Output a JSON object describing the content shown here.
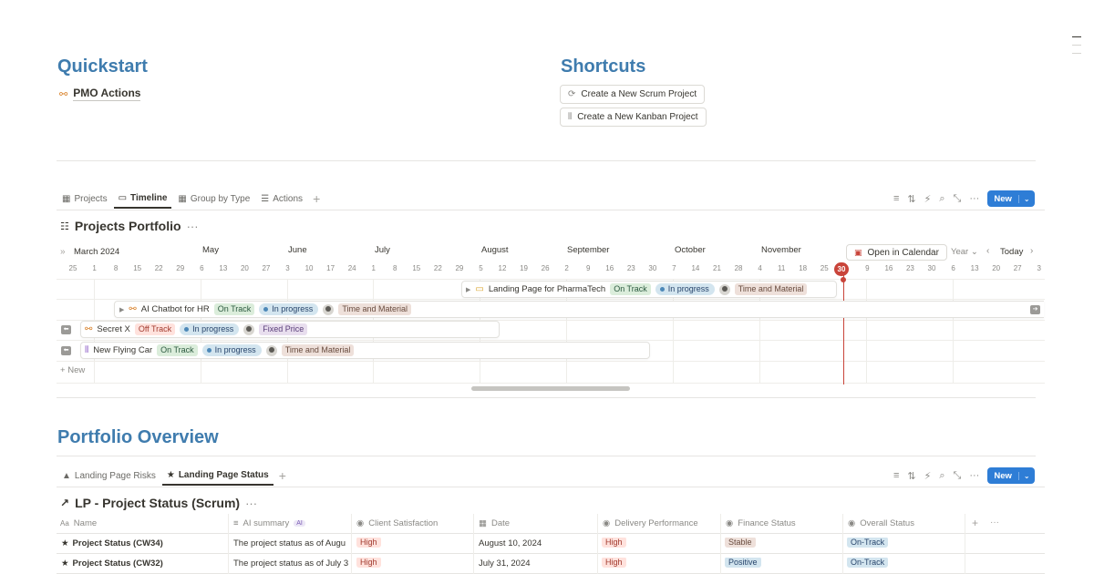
{
  "quickstart": {
    "title": "Quickstart",
    "items": [
      {
        "label": "PMO Actions"
      }
    ]
  },
  "shortcuts": {
    "title": "Shortcuts",
    "buttons": [
      {
        "label": "Create a New Scrum Project"
      },
      {
        "label": "Create a New Kanban Project"
      }
    ]
  },
  "projects_view": {
    "tabs": [
      {
        "label": "Projects"
      },
      {
        "label": "Timeline"
      },
      {
        "label": "Group by Type"
      },
      {
        "label": "Actions"
      }
    ],
    "active_tab": "Timeline",
    "new_label": "New",
    "title": "Projects Portfolio",
    "timeline": {
      "start_month": "March 2024",
      "months": [
        "May",
        "June",
        "July",
        "August",
        "September",
        "October",
        "November"
      ],
      "days": [
        "25",
        "1",
        "8",
        "15",
        "22",
        "29",
        "6",
        "13",
        "20",
        "27",
        "3",
        "10",
        "17",
        "24",
        "1",
        "8",
        "15",
        "22",
        "29",
        "5",
        "12",
        "19",
        "26",
        "2",
        "9",
        "16",
        "23",
        "30",
        "7",
        "14",
        "21",
        "28",
        "4",
        "11",
        "18",
        "25",
        "30",
        "9",
        "16",
        "23",
        "30",
        "6",
        "13",
        "20",
        "27",
        "3"
      ],
      "today_marker": "30",
      "open_calendar_label": "Open in Calendar",
      "scale_label": "Year",
      "today_label": "Today",
      "add_label": "New"
    },
    "projects": [
      {
        "name": "Landing Page for PharmaTech",
        "track": "On Track",
        "status": "In progress",
        "billing": "Time and Material"
      },
      {
        "name": "AI Chatbot for HR",
        "track": "On Track",
        "status": "In progress",
        "billing": "Time and Material"
      },
      {
        "name": "Secret X",
        "track": "Off Track",
        "status": "In progress",
        "billing": "Fixed Price"
      },
      {
        "name": "New Flying Car",
        "track": "On Track",
        "status": "In progress",
        "billing": "Time and Material"
      }
    ]
  },
  "overview": {
    "title": "Portfolio Overview",
    "tabs": [
      {
        "label": "Landing Page Risks"
      },
      {
        "label": "Landing Page Status"
      }
    ],
    "active_tab": "Landing Page Status",
    "new_label": "New",
    "db_title": "LP - Project Status (Scrum)",
    "columns": [
      {
        "icon": "Aa",
        "label": "Name"
      },
      {
        "icon": "≡",
        "label": "AI summary",
        "badge": "AI"
      },
      {
        "icon": "◉",
        "label": "Client Satisfaction"
      },
      {
        "icon": "▦",
        "label": "Date"
      },
      {
        "icon": "◉",
        "label": "Delivery Performance"
      },
      {
        "icon": "◉",
        "label": "Finance Status"
      },
      {
        "icon": "◉",
        "label": "Overall Status"
      }
    ],
    "rows": [
      {
        "name": "Project Status (CW34)",
        "summary": "The project status as of Augu",
        "client": "High",
        "date": "August 10, 2024",
        "delivery": "High",
        "finance": "Stable",
        "overall": "On-Track"
      },
      {
        "name": "Project Status (CW32)",
        "summary": "The project status as of July 3",
        "client": "High",
        "date": "July 31, 2024",
        "delivery": "High",
        "finance": "Positive",
        "overall": "On-Track"
      }
    ]
  },
  "colors": {
    "accent": "#2e7dd6",
    "heading": "#3f7cae",
    "today": "#c9443a"
  }
}
